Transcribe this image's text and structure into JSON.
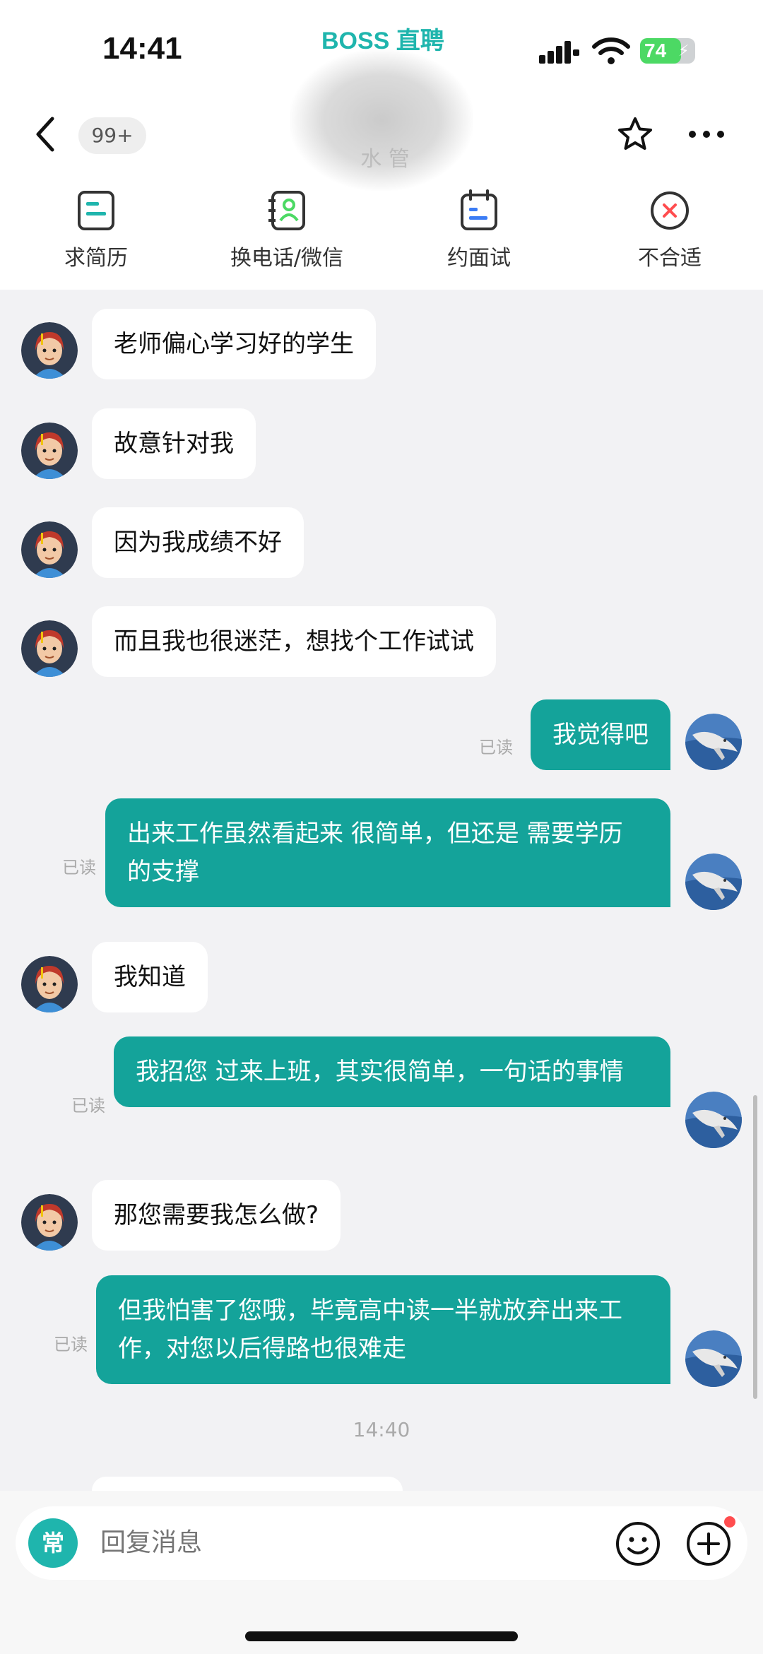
{
  "status_bar": {
    "time": "14:41",
    "brand": "BOSS 直聘",
    "battery": "74",
    "battery_level": 0.74
  },
  "header": {
    "unread_count": "99+",
    "contact_name": "水 管"
  },
  "actions": [
    {
      "label": "求简历",
      "icon": "resume-icon",
      "color": "#1fb5ad"
    },
    {
      "label": "换电话/微信",
      "icon": "exchange-contact-icon",
      "color": "#4cd964"
    },
    {
      "label": "约面试",
      "icon": "calendar-icon",
      "color": "#3b7cf5"
    },
    {
      "label": "不合适",
      "icon": "close-circle-icon",
      "color": "#ff4d4f"
    }
  ],
  "messages": [
    {
      "side": "in",
      "text": "老师偏心学习好的学生"
    },
    {
      "side": "in",
      "text": "故意针对我"
    },
    {
      "side": "in",
      "text": "因为我成绩不好"
    },
    {
      "side": "in",
      "text": "而且我也很迷茫，想找个工作试试"
    },
    {
      "side": "out",
      "text": "我觉得吧",
      "read": "已读"
    },
    {
      "side": "out",
      "text": "出来工作虽然看起来 很简单，但还是 需要学历 的支撑",
      "read": "已读"
    },
    {
      "side": "in",
      "text": "我知道"
    },
    {
      "side": "out",
      "text": "我招您 过来上班，其实很简单，一句话的事情",
      "read": "已读"
    },
    {
      "side": "in",
      "text": "那您需要我怎么做?"
    },
    {
      "side": "out",
      "text": "但我怕害了您哦，毕竟高中读一半就放弃出来工作，对您以后得路也很难走",
      "read": "已读"
    }
  ],
  "timestamp": "14:40",
  "input": {
    "quick_label": "常",
    "placeholder": "回复消息"
  },
  "colors": {
    "accent": "#1fb5ad",
    "outgoing_bubble": "#14a39a",
    "badge_dot": "#ff4d4f"
  }
}
